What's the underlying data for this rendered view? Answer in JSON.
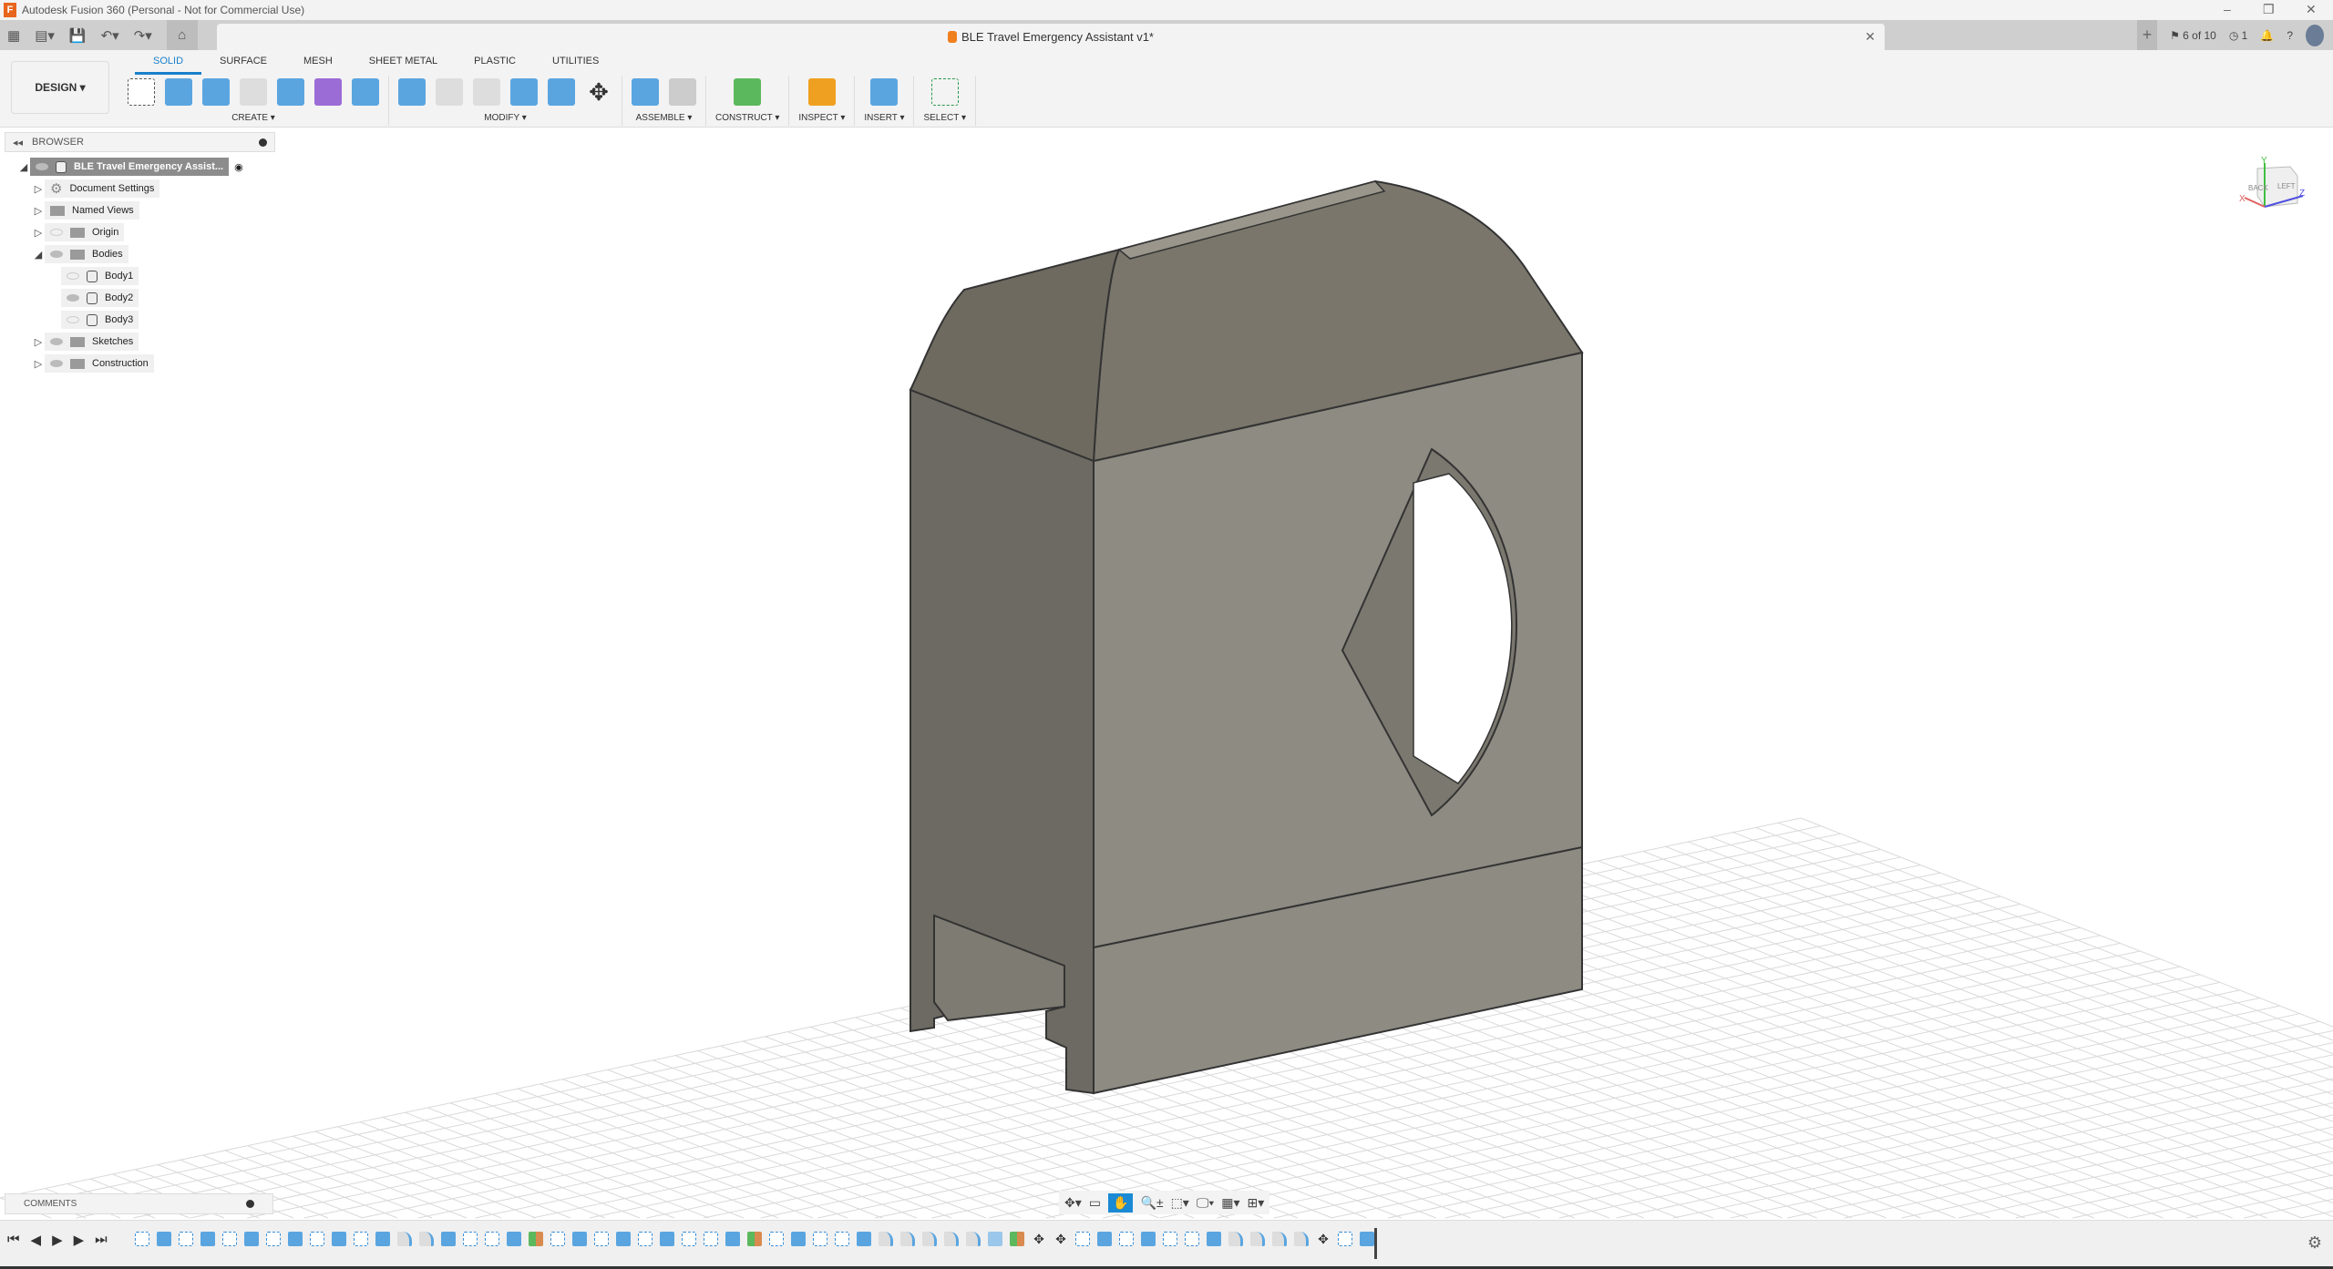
{
  "titlebar": {
    "app_title": "Autodesk Fusion 360 (Personal - Not for Commercial Use)",
    "logo": "F"
  },
  "tabbar": {
    "document_title": "BLE Travel Emergency Assistant v1*",
    "job_status": "6 of 10",
    "notifications": "1"
  },
  "toolbar": {
    "workspace": "DESIGN ▾",
    "tabs": [
      "SOLID",
      "SURFACE",
      "MESH",
      "SHEET METAL",
      "PLASTIC",
      "UTILITIES"
    ],
    "groups": [
      {
        "label": "CREATE ▾",
        "icons": [
          "new-sketch",
          "extrude",
          "revolve",
          "hole",
          "pattern",
          "create-form",
          "loft"
        ]
      },
      {
        "label": "MODIFY ▾",
        "icons": [
          "press-pull",
          "fillet",
          "shell",
          "combine",
          "split",
          "move"
        ]
      },
      {
        "label": "ASSEMBLE ▾",
        "icons": [
          "new-component",
          "joint"
        ]
      },
      {
        "label": "CONSTRUCT ▾",
        "icons": [
          "offset-plane"
        ]
      },
      {
        "label": "INSPECT ▾",
        "icons": [
          "measure"
        ]
      },
      {
        "label": "INSERT ▾",
        "icons": [
          "insert-image"
        ]
      },
      {
        "label": "SELECT ▾",
        "icons": [
          "select-box"
        ]
      }
    ]
  },
  "browser": {
    "title": "BROWSER",
    "root": "BLE Travel Emergency Assist...",
    "items": [
      {
        "label": "Document Settings",
        "type": "settings",
        "level": 1
      },
      {
        "label": "Named Views",
        "type": "folder",
        "level": 1
      },
      {
        "label": "Origin",
        "type": "folder",
        "level": 1,
        "hidden": true
      },
      {
        "label": "Bodies",
        "type": "folder",
        "level": 1,
        "expanded": true
      },
      {
        "label": "Body1",
        "type": "body",
        "level": 2,
        "hidden": true
      },
      {
        "label": "Body2",
        "type": "body",
        "level": 2
      },
      {
        "label": "Body3",
        "type": "body",
        "level": 2,
        "hidden": true
      },
      {
        "label": "Sketches",
        "type": "folder",
        "level": 1
      },
      {
        "label": "Construction",
        "type": "folder",
        "level": 1
      }
    ]
  },
  "viewcube": {
    "faces": [
      "BACK",
      "LEFT"
    ],
    "axes": [
      "X",
      "Y",
      "Z"
    ],
    "colors": {
      "x": "#e06060",
      "y": "#40c040",
      "z": "#5050e0"
    }
  },
  "comments": {
    "title": "COMMENTS"
  },
  "timeline": {
    "items": [
      "sketch",
      "extrude",
      "sketch",
      "extrude",
      "sketch",
      "extrude",
      "sketch",
      "extrude",
      "sketch",
      "extrude",
      "sketch",
      "extrude",
      "fillet",
      "fillet",
      "extrude",
      "sketch",
      "sketch",
      "extrude",
      "plane",
      "sketch",
      "extrude",
      "sketch",
      "extrude",
      "sketch",
      "extrude",
      "sketch",
      "sketch",
      "extrude",
      "plane",
      "sketch",
      "extrude",
      "sketch",
      "sketch",
      "extrude",
      "fillet",
      "fillet",
      "fillet",
      "fillet",
      "fillet",
      "combine",
      "plane",
      "move",
      "move",
      "sketch",
      "extrude",
      "sketch",
      "extrude",
      "sketch",
      "sketch",
      "extrude",
      "fillet",
      "fillet",
      "fillet",
      "fillet",
      "move",
      "sketch",
      "extrude"
    ]
  }
}
